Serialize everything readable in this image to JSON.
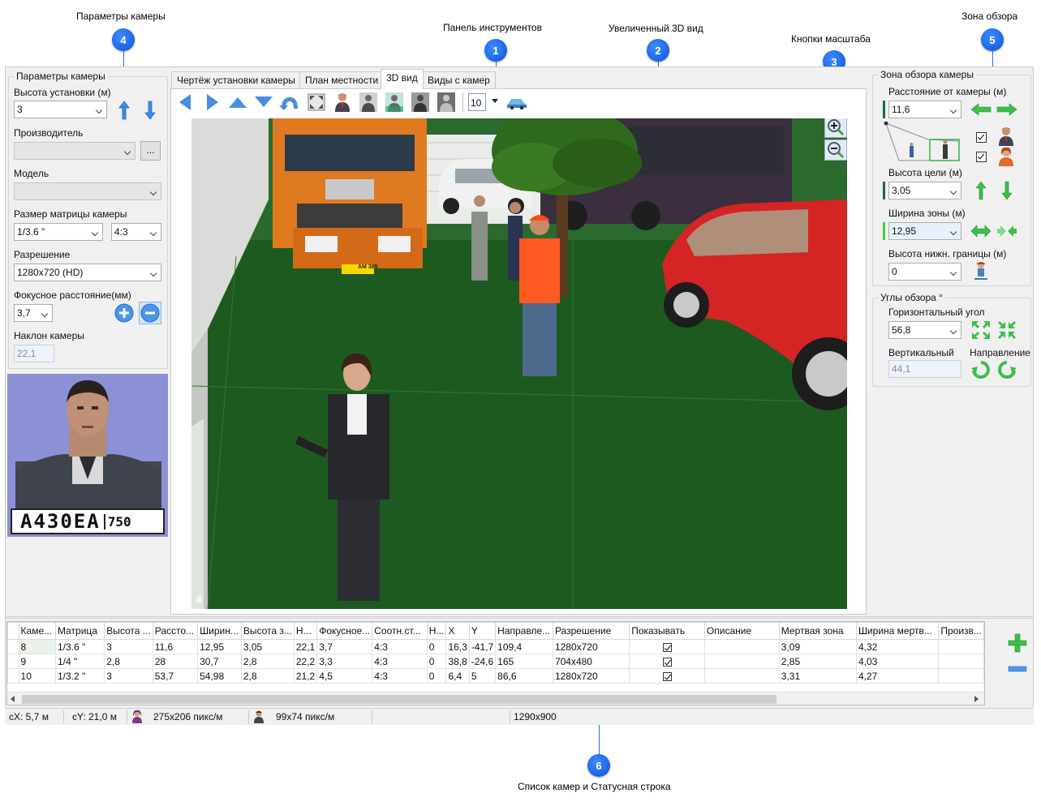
{
  "callouts": {
    "camera_params": "Параметры камеры",
    "toolbar": "Панель инструментов",
    "zoomed_3d": "Увеличенный 3D вид",
    "zoom_buttons": "Кнопки масштаба",
    "view_zone": "Зона обзора",
    "camera_list": "Список камер и Статусная строка",
    "badges": [
      "1",
      "2",
      "3",
      "4",
      "5",
      "6"
    ]
  },
  "left_panel": {
    "title": "Параметры камеры",
    "mount_height_label": "Высота установки (м)",
    "mount_height_value": "3",
    "manufacturer_label": "Производитель",
    "manufacturer_value": "",
    "browse_button": "...",
    "model_label": "Модель",
    "model_value": "",
    "sensor_label": "Размер матрицы камеры",
    "sensor_value": "1/3.6 \"",
    "aspect_value": "4:3",
    "resolution_label": "Разрешение",
    "resolution_value": "1280x720 (HD)",
    "focal_label": "Фокусное расстояние(мм)",
    "focal_value": "3,7",
    "tilt_label": "Наклон камеры",
    "tilt_value": "22,1",
    "plate_text": "А430ЕА",
    "plate_region": "750"
  },
  "tabs": [
    {
      "label": "Чертёж установки камеры"
    },
    {
      "label": "План местности"
    },
    {
      "label": "3D вид"
    },
    {
      "label": "Виды с камер"
    }
  ],
  "toolbar": {
    "zoom_level": "10"
  },
  "view3d": {
    "camera_number": "8",
    "truck_plate": "АМ 385"
  },
  "right_panel": {
    "zone_title": "Зона обзора камеры",
    "distance_label": "Расстояние от камеры (м)",
    "distance_value": "11,6",
    "target_height_label": "Высота цели (м)",
    "target_height_value": "3,05",
    "zone_width_label": "Ширина зоны (м)",
    "zone_width_value": "12,95",
    "lower_bound_label": "Высота нижн. границы (м)",
    "lower_bound_value": "0",
    "angles_title": "Углы обзора °",
    "horizontal_label": "Горизонтальный угол",
    "horizontal_value": "56,8",
    "vertical_label": "Вертикальный",
    "vertical_value": "44,1",
    "direction_label": "Направление"
  },
  "grid": {
    "columns": [
      "Каме...",
      "Матрица",
      "Высота ...",
      "Рассто...",
      "Ширин...",
      "Высота з...",
      "Н...",
      "Фокусное...",
      "Соотн.ст...",
      "Н...",
      "X",
      "Y",
      "Направле...",
      "Разрешение",
      "Показывать",
      "Описание",
      "Мертвая зона",
      "Ширина мертв...",
      "Произв..."
    ],
    "rows": [
      [
        "8",
        "1/3.6 \"",
        "3",
        "11,6",
        "12,95",
        "3,05",
        "22,1",
        "3,7",
        "4:3",
        "0",
        "16,3",
        "-41,7",
        "109,4",
        "1280x720",
        "✓",
        "",
        "3,09",
        "4,32",
        ""
      ],
      [
        "9",
        "1/4 \"",
        "2,8",
        "28",
        "30,7",
        "2,8",
        "22,2",
        "3,3",
        "4:3",
        "0",
        "38,8",
        "-24,6",
        "165",
        "704x480",
        "✓",
        "",
        "2,85",
        "4,03",
        ""
      ],
      [
        "10",
        "1/3.2 \"",
        "3",
        "53,7",
        "54,98",
        "2,8",
        "21,2",
        "4,5",
        "4:3",
        "0",
        "6,4",
        "5",
        "86,6",
        "1280x720",
        "✓",
        "",
        "3,31",
        "4,27",
        ""
      ]
    ]
  },
  "status": {
    "cx": "cX: 5,7 м",
    "cy": "cY: 21,0 м",
    "face_pixels": "275x206 пикс/м",
    "person_pixels": "99x74 пикс/м",
    "window_size": "1290x900"
  },
  "colors": {
    "accent_blue": "#1e6cf0",
    "arrow_blue": "#3b8ee8",
    "arrow_green": "#3cbf4a",
    "ground_green": "#1d5a20"
  }
}
